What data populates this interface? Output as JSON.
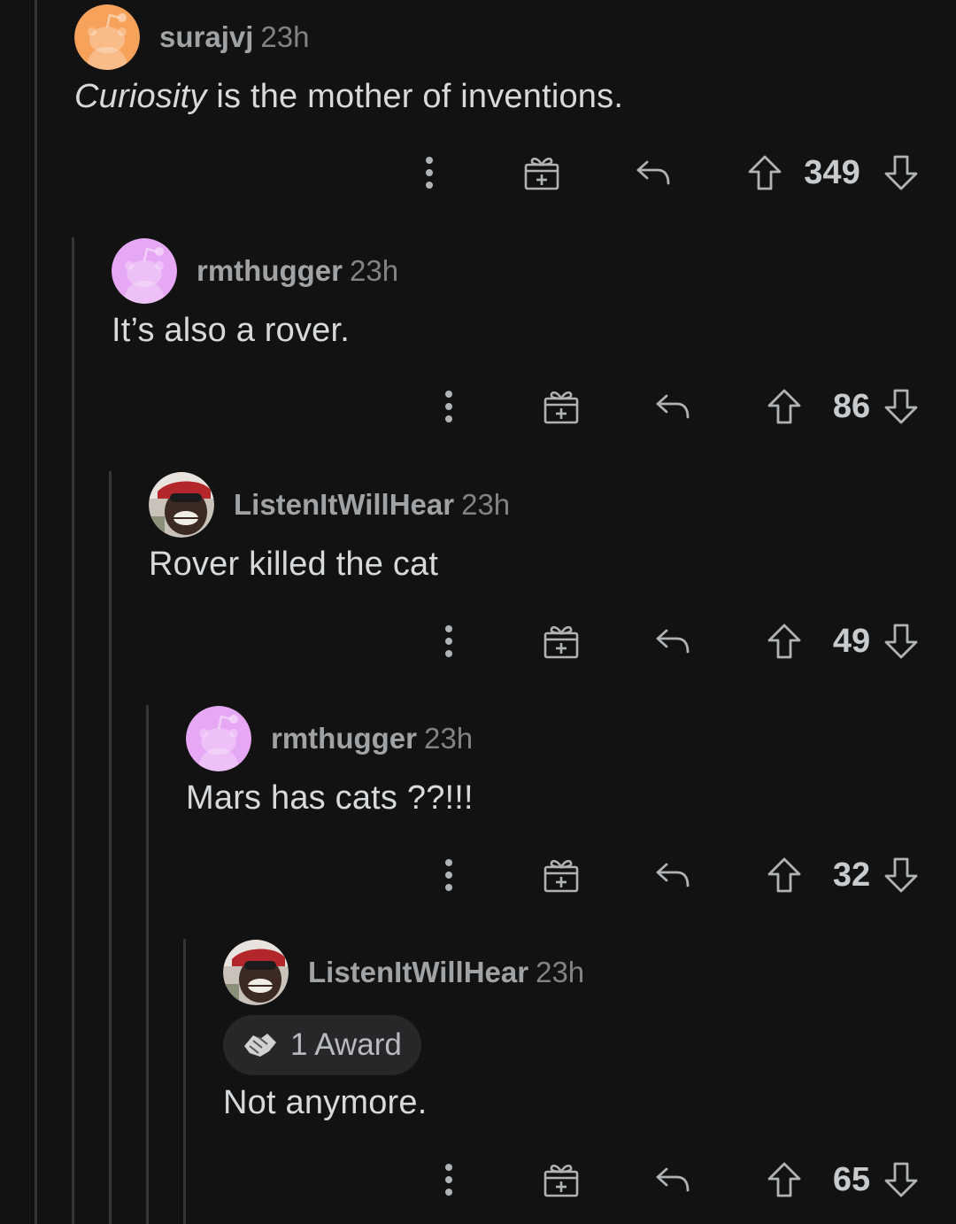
{
  "comments": [
    {
      "username": "surajvj",
      "age": "23h",
      "body_em": "Curiosity",
      "body": " is the mother of inventions.",
      "score": "349",
      "avatar_color": "#f7a25b",
      "avatar_type": "snoo"
    },
    {
      "username": "rmthugger",
      "age": "23h",
      "body_em": "",
      "body": "It’s also a rover.",
      "score": "86",
      "avatar_color": "#e6a8f4",
      "avatar_type": "snoo"
    },
    {
      "username": "ListenItWillHear",
      "age": "23h",
      "body_em": "",
      "body": "Rover killed the cat",
      "score": "49",
      "avatar_color": "#8a3b2a",
      "avatar_type": "photo"
    },
    {
      "username": "rmthugger",
      "age": "23h",
      "body_em": "",
      "body": "Mars has cats ??!!!",
      "score": "32",
      "avatar_color": "#e6a8f4",
      "avatar_type": "snoo"
    },
    {
      "username": "ListenItWillHear",
      "age": "23h",
      "award": "1 Award",
      "body_em": "",
      "body": "Not anymore.",
      "score": "65",
      "avatar_color": "#8a3b2a",
      "avatar_type": "photo"
    }
  ],
  "icons": {
    "more": "more-options-icon",
    "gift": "gift-award-icon",
    "reply": "reply-icon",
    "upvote": "upvote-arrow-icon",
    "downvote": "downvote-arrow-icon",
    "award": "handshake-award-icon"
  },
  "colors": {
    "background": "#121212",
    "thread_line": "#343536",
    "text": "#d7dadc",
    "meta": "#818384"
  }
}
